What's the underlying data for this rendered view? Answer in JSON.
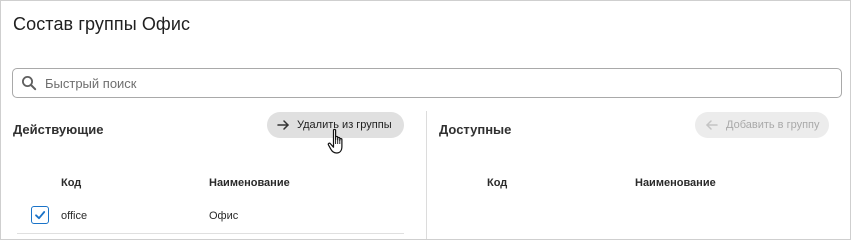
{
  "page": {
    "title": "Состав группы Офис"
  },
  "search": {
    "placeholder": "Быстрый поиск",
    "icon": "search-icon"
  },
  "active_panel": {
    "title": "Действующие",
    "remove_button_label": "Удалить из группы",
    "columns": [
      "Код",
      "Наименование"
    ],
    "rows": [
      {
        "checked": true,
        "code": "office",
        "name": "Офис"
      }
    ]
  },
  "available_panel": {
    "title": "Доступные",
    "add_button_label": "Добавить в группу",
    "add_button_enabled": false,
    "columns": [
      "Код",
      "Наименование"
    ],
    "rows": []
  },
  "colors": {
    "accent": "#1a73c8",
    "button_bg": "#e0e0e0",
    "disabled_text": "#a9a9a9"
  }
}
